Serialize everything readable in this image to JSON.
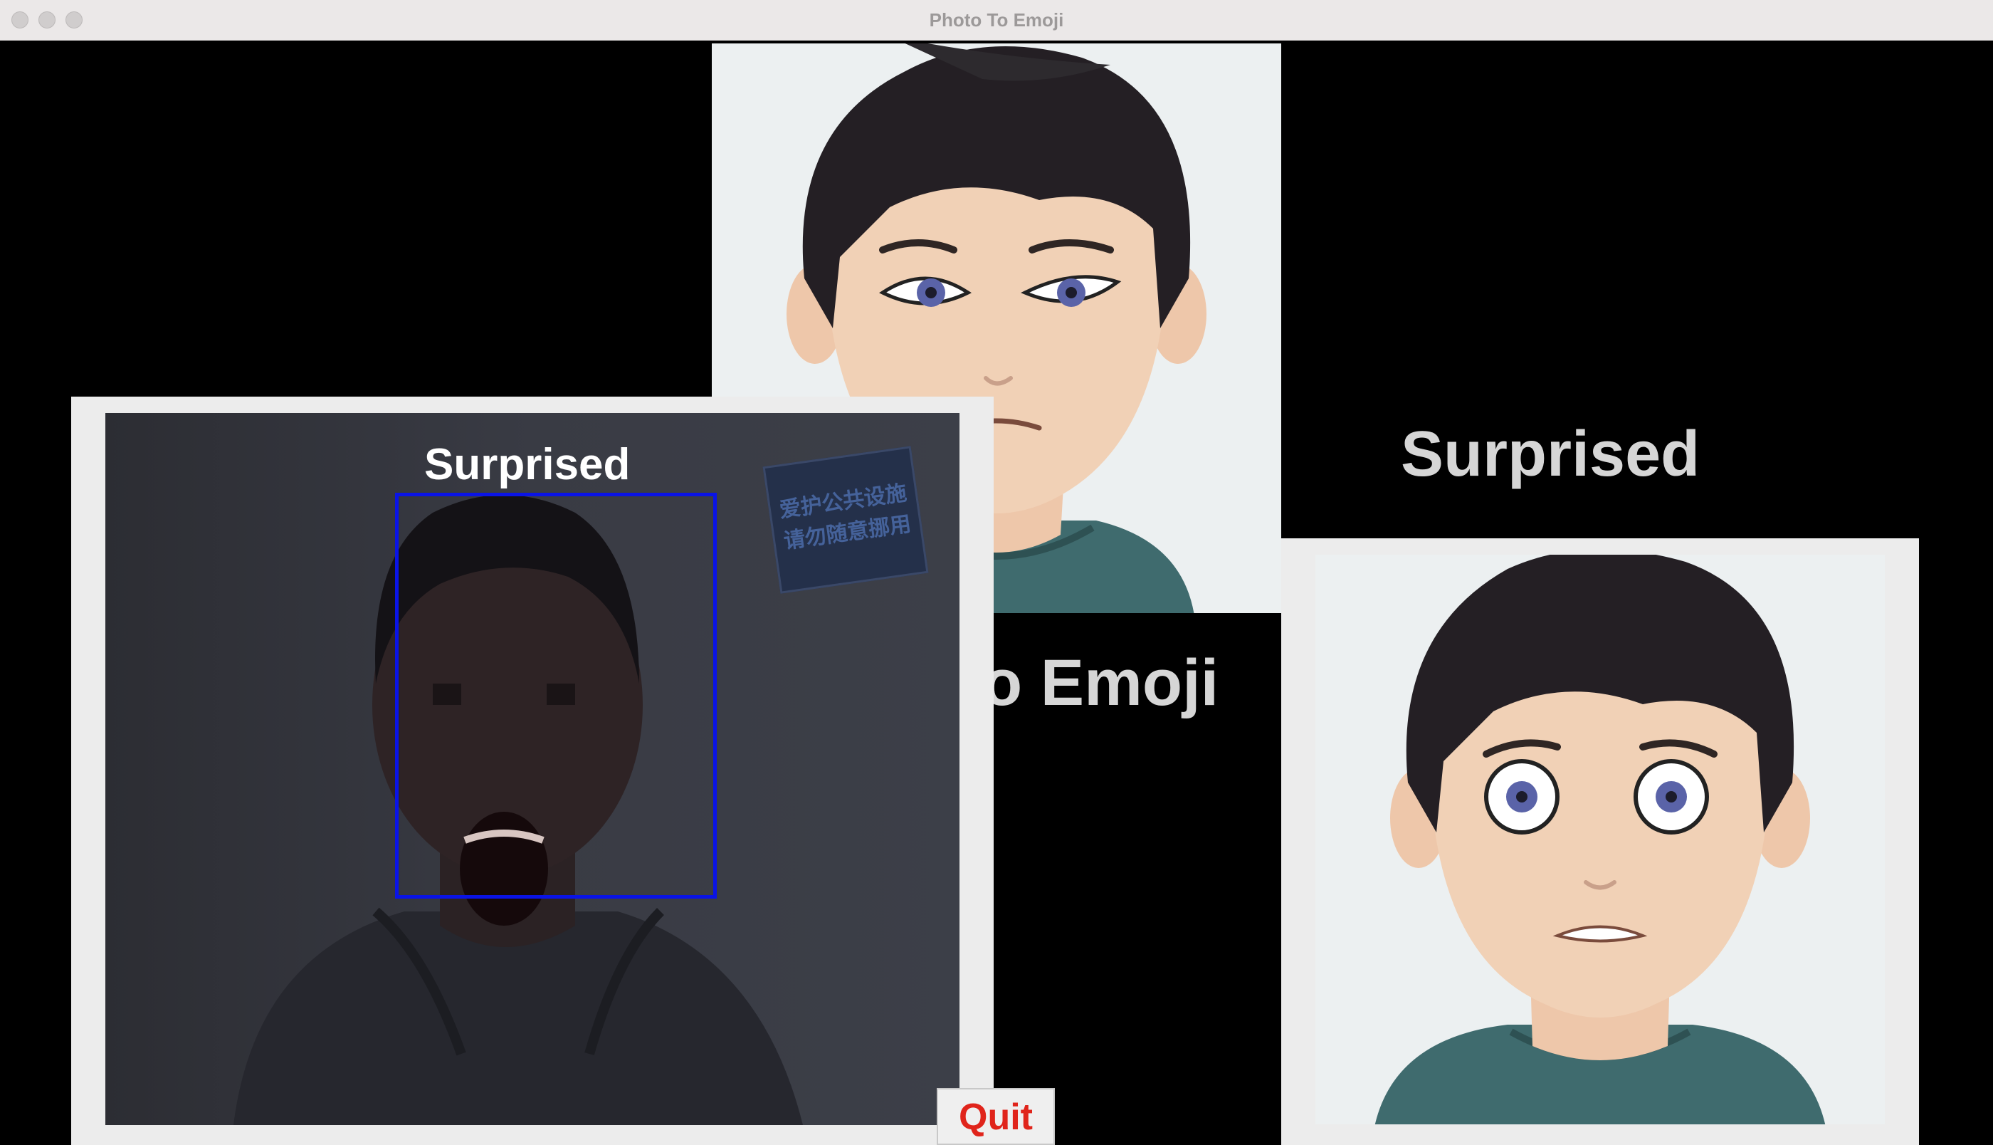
{
  "window": {
    "title": "Photo To Emoji"
  },
  "webcam": {
    "emotion_label": "Surprised",
    "sign_lines": [
      "爱护公共设施",
      "请勿随意挪用"
    ]
  },
  "result": {
    "emotion_text": "Surprised"
  },
  "background_title": {
    "visible_fragment": "o Emoji"
  },
  "controls": {
    "quit_label": "Quit"
  },
  "colors": {
    "face_box": "#0a14e6",
    "quit_text": "#e0241b",
    "label_text": "#d6d6d6",
    "shirt": "#3f6b6e",
    "hair": "#241f24",
    "skin": "#f1d1b6"
  }
}
